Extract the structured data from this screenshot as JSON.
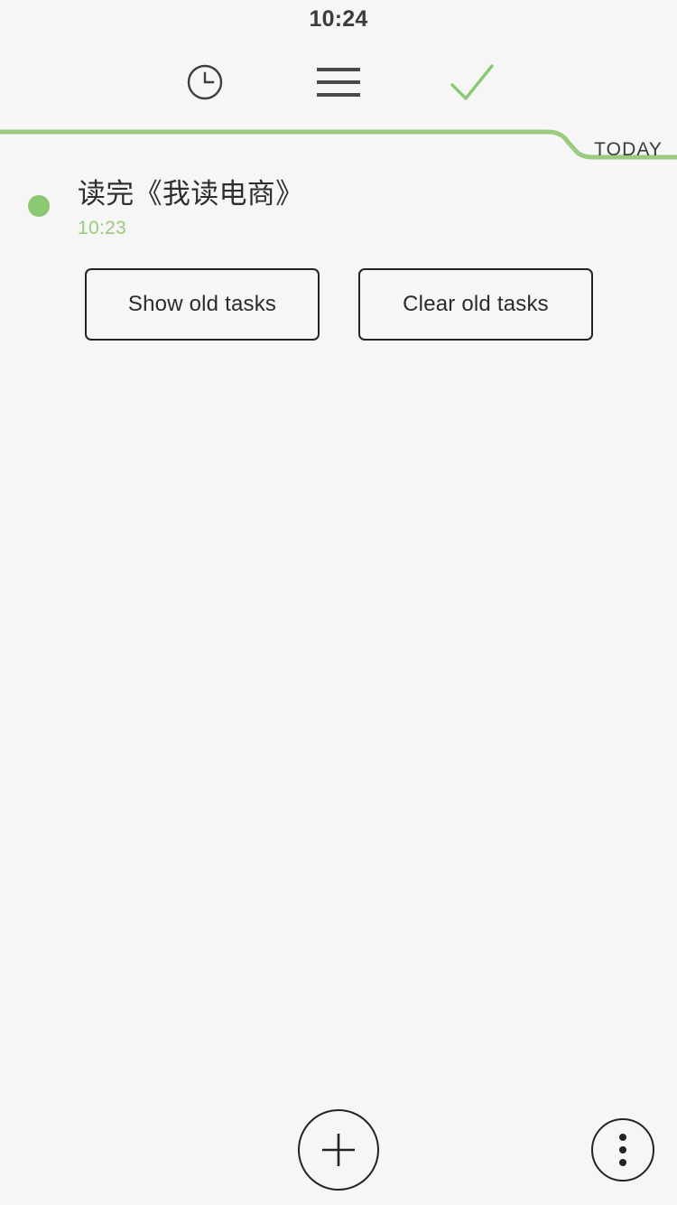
{
  "colors": {
    "background": "#f6f6f6",
    "accent_green": "#8cc873",
    "accent_green_light": "#9bcb80",
    "text_dark": "#2e2e2e",
    "outline_dark": "#232323"
  },
  "status_bar": {
    "clock": "10:24"
  },
  "top_nav": {
    "items": [
      {
        "icon": "clock-icon",
        "label": "Clock"
      },
      {
        "icon": "hamburger-menu-icon",
        "label": "Menu"
      },
      {
        "icon": "check-icon",
        "label": "Done"
      }
    ]
  },
  "divider": {
    "label": "TODAY"
  },
  "tasks": [
    {
      "title": "读完《我读电商》",
      "time": "10:23",
      "dot_color": "#8cc873"
    }
  ],
  "old_task_actions": {
    "show_label": "Show old tasks",
    "clear_label": "Clear old tasks"
  },
  "bottom_bar": {
    "add_icon": "plus-icon",
    "more_icon": "three-dot-menu-icon"
  }
}
